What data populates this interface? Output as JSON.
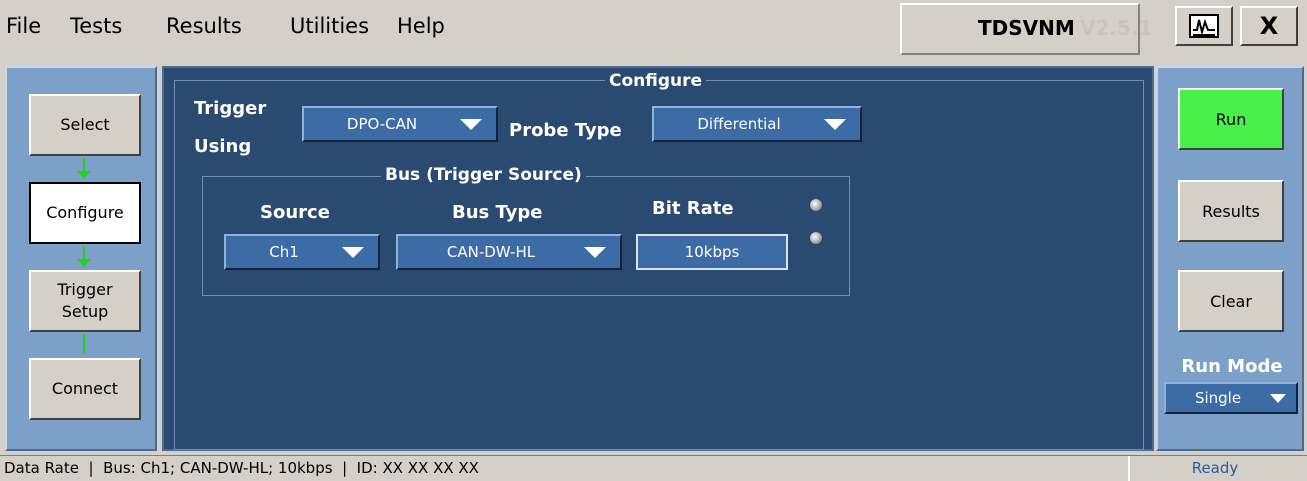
{
  "menu": {
    "file": "File",
    "tests": "Tests",
    "results": "Results",
    "utilities": "Utilities",
    "help": "Help"
  },
  "brand": {
    "title": "TDSVNM",
    "version": "V2.5.1"
  },
  "window": {
    "close_label": "X"
  },
  "steps": {
    "select": "Select",
    "configure": "Configure",
    "trigger_line1": "Trigger",
    "trigger_line2": "Setup",
    "connect": "Connect"
  },
  "configure": {
    "title": "Configure",
    "trigger_label_1": "Trigger",
    "trigger_label_2": "Using",
    "trigger_using_value": "DPO-CAN",
    "probe_type_label": "Probe Type",
    "probe_type_value": "Differential",
    "bus": {
      "title": "Bus (Trigger Source)",
      "source_label": "Source",
      "source_value": "Ch1",
      "bus_type_label": "Bus Type",
      "bus_type_value": "CAN-DW-HL",
      "bit_rate_label": "Bit Rate",
      "bit_rate_value": "10kbps"
    }
  },
  "actions": {
    "run": "Run",
    "results": "Results",
    "clear": "Clear",
    "run_mode_label": "Run Mode",
    "run_mode_value": "Single"
  },
  "status": {
    "text": "Data Rate  |  Bus: Ch1; CAN-DW-HL; 10kbps  |  ID: XX XX XX XX",
    "ready": "Ready"
  },
  "colors": {
    "panel_bg": "#2b4a72",
    "side_panel_bg": "#7da0c8",
    "dropdown_bg": "#3c6ba6",
    "run_green": "#48f048",
    "arrow_green": "#1fd41f"
  }
}
